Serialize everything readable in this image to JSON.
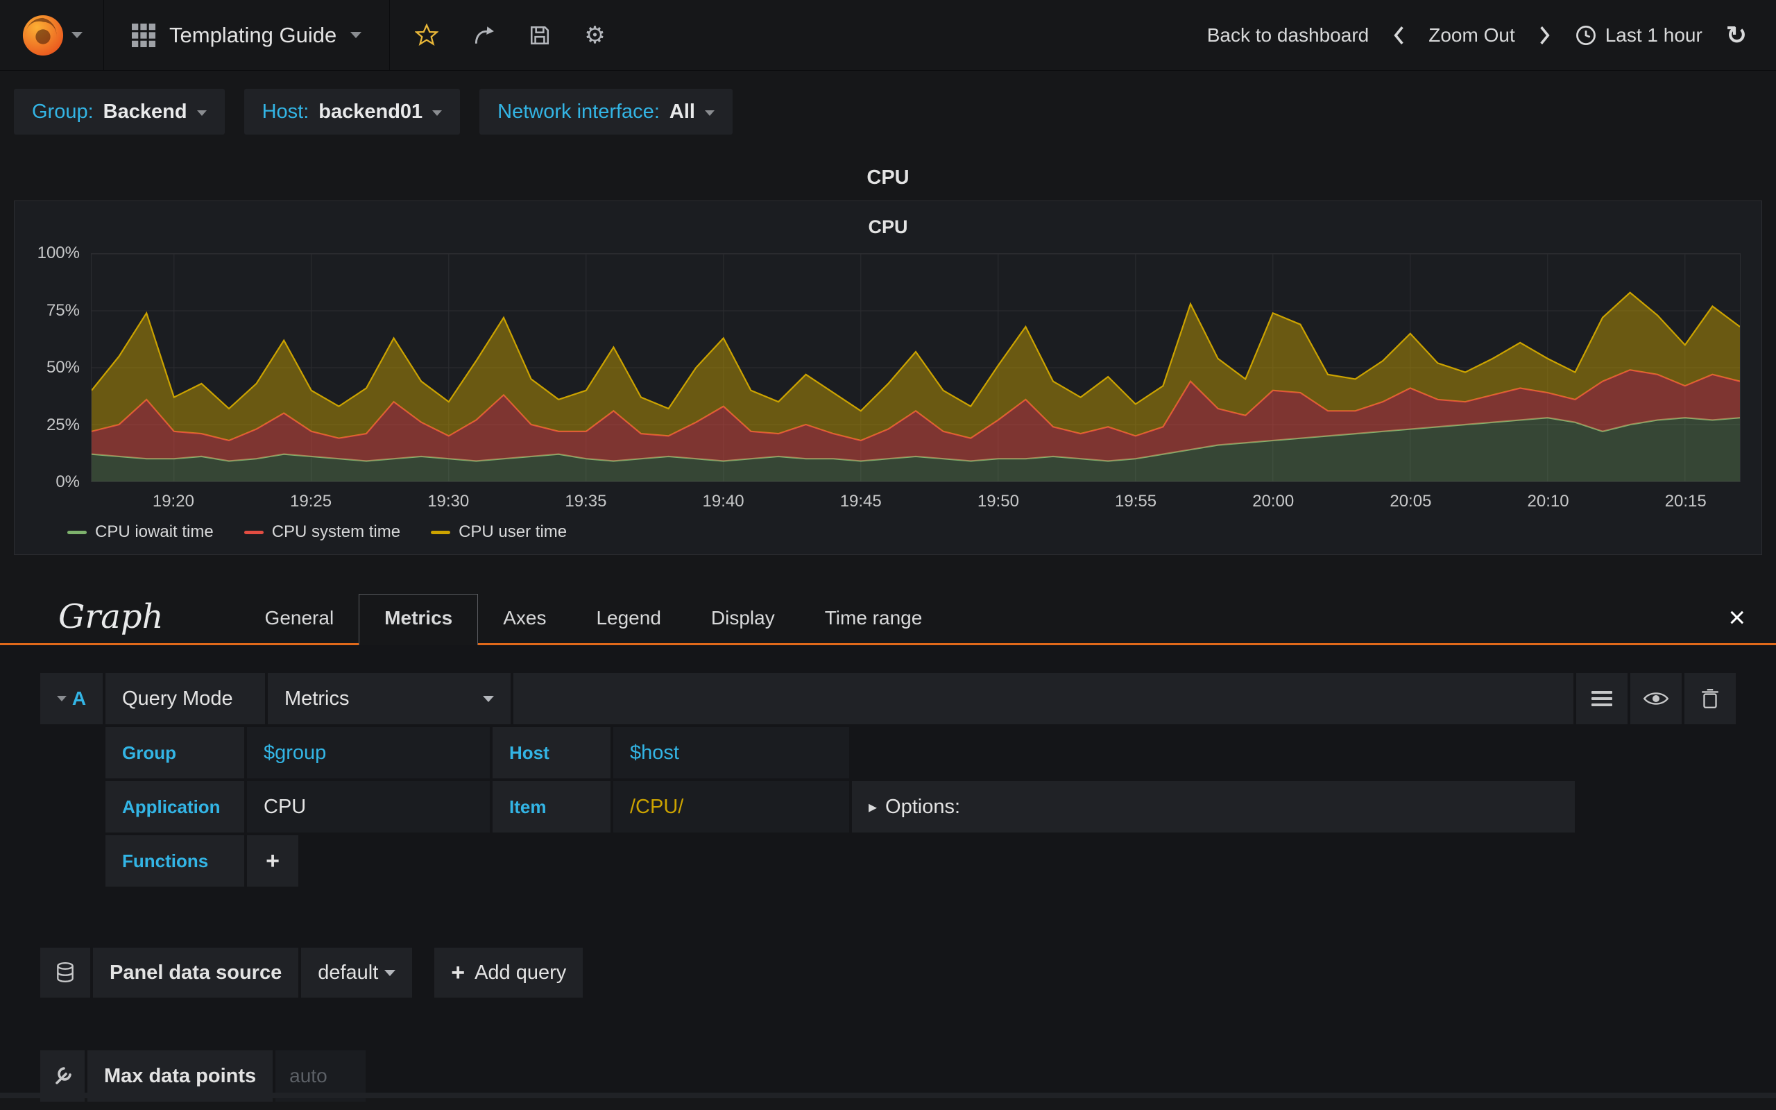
{
  "navbar": {
    "title": "Templating Guide",
    "back_to_dashboard": "Back to dashboard",
    "zoom_out": "Zoom Out",
    "time_range": "Last 1 hour"
  },
  "variables": [
    {
      "label": "Group:",
      "value": "Backend"
    },
    {
      "label": "Host:",
      "value": "backend01"
    },
    {
      "label": "Network interface:",
      "value": "All"
    }
  ],
  "panel": {
    "row_title": "CPU",
    "title": "CPU"
  },
  "chart_data": {
    "type": "area",
    "stacked": true,
    "title": "CPU",
    "x_range": [
      "19:17",
      "20:17"
    ],
    "x_ticks": [
      "19:20",
      "19:25",
      "19:30",
      "19:35",
      "19:40",
      "19:45",
      "19:50",
      "19:55",
      "20:00",
      "20:05",
      "20:10",
      "20:15"
    ],
    "y_ticks": [
      "0%",
      "25%",
      "50%",
      "75%",
      "100%"
    ],
    "ylim": [
      0,
      100
    ],
    "grid": true,
    "legend_position": "bottom-left",
    "series": [
      {
        "name": "CPU iowait time",
        "color": "#7eb26d",
        "fill": "rgba(126,178,109,0.28)",
        "values": [
          12,
          11,
          10,
          10,
          11,
          9,
          10,
          12,
          11,
          10,
          9,
          10,
          11,
          10,
          9,
          10,
          11,
          12,
          10,
          9,
          10,
          11,
          10,
          9,
          10,
          11,
          10,
          10,
          9,
          10,
          11,
          10,
          9,
          10,
          10,
          11,
          10,
          9,
          10,
          12,
          14,
          16,
          17,
          18,
          19,
          20,
          21,
          22,
          23,
          24,
          25,
          26,
          27,
          28,
          26,
          22,
          25,
          27,
          28,
          27,
          28
        ]
      },
      {
        "name": "CPU system time",
        "color": "#e24d42",
        "fill": "rgba(226,77,66,0.5)",
        "values": [
          10,
          14,
          26,
          12,
          10,
          9,
          13,
          18,
          11,
          9,
          12,
          25,
          15,
          10,
          18,
          28,
          14,
          10,
          12,
          22,
          11,
          9,
          16,
          24,
          12,
          10,
          15,
          11,
          9,
          13,
          20,
          12,
          10,
          17,
          26,
          13,
          11,
          15,
          10,
          12,
          30,
          16,
          12,
          22,
          20,
          11,
          10,
          13,
          18,
          12,
          10,
          12,
          14,
          11,
          10,
          22,
          24,
          20,
          14,
          20,
          16
        ]
      },
      {
        "name": "CPU user time",
        "color": "#cca300",
        "fill": "rgba(204,163,0,0.45)",
        "values": [
          18,
          30,
          38,
          15,
          22,
          14,
          20,
          32,
          18,
          14,
          20,
          28,
          18,
          15,
          26,
          34,
          20,
          14,
          18,
          28,
          16,
          12,
          24,
          30,
          18,
          14,
          22,
          18,
          13,
          20,
          26,
          18,
          14,
          24,
          32,
          20,
          16,
          22,
          14,
          18,
          34,
          22,
          16,
          34,
          30,
          16,
          14,
          18,
          24,
          16,
          13,
          16,
          20,
          15,
          12,
          28,
          34,
          26,
          18,
          30,
          24
        ]
      }
    ]
  },
  "editor": {
    "panel_type": "Graph",
    "tabs": [
      "General",
      "Metrics",
      "Axes",
      "Legend",
      "Display",
      "Time range"
    ],
    "active_tab": "Metrics",
    "close_label": "×",
    "query": {
      "ref_id": "A",
      "query_mode_label": "Query Mode",
      "query_mode_value": "Metrics",
      "group_label": "Group",
      "group_value": "$group",
      "host_label": "Host",
      "host_value": "$host",
      "application_label": "Application",
      "application_value": "CPU",
      "item_label": "Item",
      "item_value": "/CPU/",
      "options_label": "Options:",
      "functions_label": "Functions",
      "add_function_label": "+"
    },
    "datasource": {
      "label": "Panel data source",
      "value": "default",
      "add_query_plus": "+",
      "add_query_label": "Add query"
    },
    "max_data_points": {
      "label": "Max data points",
      "placeholder": "auto"
    }
  }
}
